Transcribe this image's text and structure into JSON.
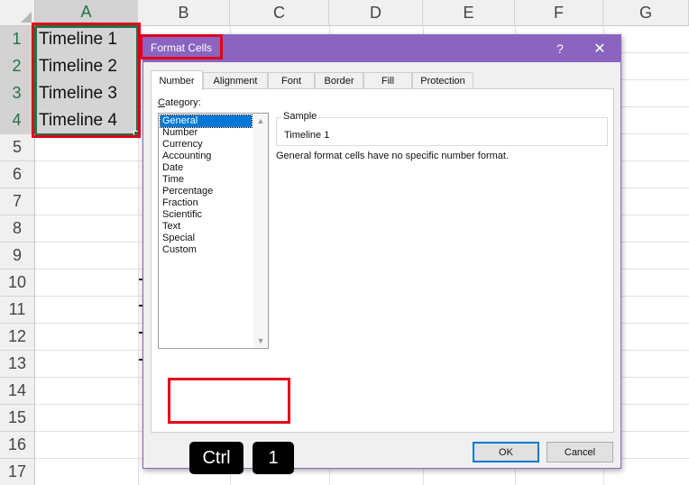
{
  "spreadsheet": {
    "columns": [
      "A",
      "B",
      "C",
      "D",
      "E",
      "F",
      "G"
    ],
    "rows": [
      "1",
      "2",
      "3",
      "4",
      "5",
      "6",
      "7",
      "8",
      "9",
      "10",
      "11",
      "12",
      "13",
      "14",
      "15",
      "16",
      "17"
    ],
    "cells": [
      "Timeline 1",
      "Timeline 2",
      "Timeline 3",
      "Timeline 4"
    ],
    "selection_color": "#217346"
  },
  "dialog": {
    "title": "Format Cells",
    "help_label": "?",
    "close_label": "✕",
    "accent_color": "#8b64c0",
    "tabs": [
      "Number",
      "Alignment",
      "Font",
      "Border",
      "Fill",
      "Protection"
    ],
    "active_tab": "Number",
    "category_label_prefix": "C",
    "category_label_rest": "ategory:",
    "categories": [
      "General",
      "Number",
      "Currency",
      "Accounting",
      "Date",
      "Time",
      "Percentage",
      "Fraction",
      "Scientific",
      "Text",
      "Special",
      "Custom"
    ],
    "selected_category": "General",
    "scroll_up_icon": "▲",
    "scroll_down_icon": "▼",
    "sample_label": "Sample",
    "sample_value": "Timeline 1",
    "description": "General format cells have no specific number format.",
    "ok_label": "OK",
    "cancel_label": "Cancel"
  },
  "shortcut": {
    "keys": [
      "Ctrl",
      "1"
    ]
  },
  "highlight_color": "#e0001b"
}
